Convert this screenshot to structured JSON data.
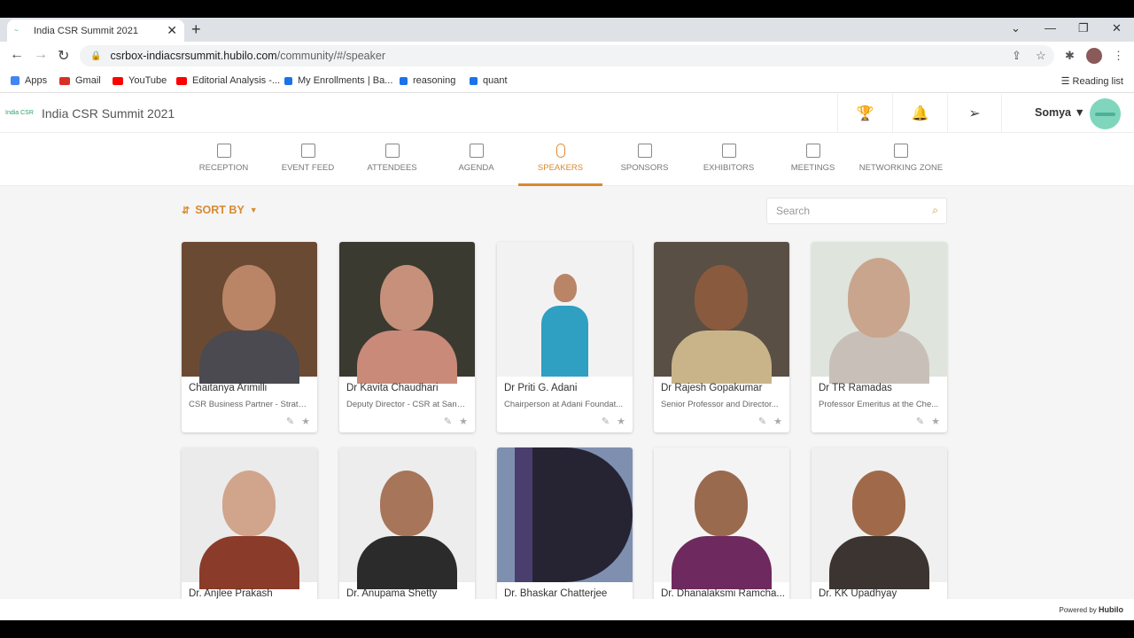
{
  "browser": {
    "tab_title": "India CSR Summit 2021",
    "url_host": "csrbox-indiacsrsummit.hubilo.com",
    "url_path": "/community/#/speaker",
    "bookmarks": [
      "Apps",
      "Gmail",
      "YouTube",
      "Editorial Analysis -...",
      "My Enrollments | Ba...",
      "reasoning",
      "quant"
    ],
    "reading_list": "Reading list"
  },
  "app": {
    "brand_name": "India CSR Summit 2021",
    "logo_text": "India CSR",
    "user_name": "Somya",
    "nav": [
      "RECEPTION",
      "EVENT FEED",
      "ATTENDEES",
      "AGENDA",
      "SPEAKERS",
      "SPONSORS",
      "EXHIBITORS",
      "MEETINGS",
      "NETWORKING ZONE"
    ],
    "active_nav": "SPEAKERS",
    "sort_label": "SORT BY",
    "search_placeholder": "Search",
    "powered_by": "Powered by",
    "powered_brand": "Hubilo"
  },
  "speakers": [
    {
      "name": "Chaitanya Arimilli",
      "title": "CSR Business Partner - Strate..."
    },
    {
      "name": "Dr Kavita Chaudhari",
      "title": "Deputy Director - CSR at Sano..."
    },
    {
      "name": "Dr Priti G. Adani",
      "title": "Chairperson at Adani Foundat..."
    },
    {
      "name": "Dr Rajesh Gopakumar",
      "title": "Senior Professor and Director..."
    },
    {
      "name": "Dr TR Ramadas",
      "title": "Professor Emeritus at the Che..."
    },
    {
      "name": "Dr. Anjlee Prakash",
      "title": ""
    },
    {
      "name": "Dr. Anupama Shetty",
      "title": ""
    },
    {
      "name": "Dr. Bhaskar Chatterjee",
      "title": ""
    },
    {
      "name": "Dr. Dhanalaksmi Ramcha...",
      "title": ""
    },
    {
      "name": "Dr. KK Upadhyay",
      "title": ""
    }
  ],
  "colors": {
    "accent": "#d98a2f",
    "background": "#f5f5f5"
  }
}
